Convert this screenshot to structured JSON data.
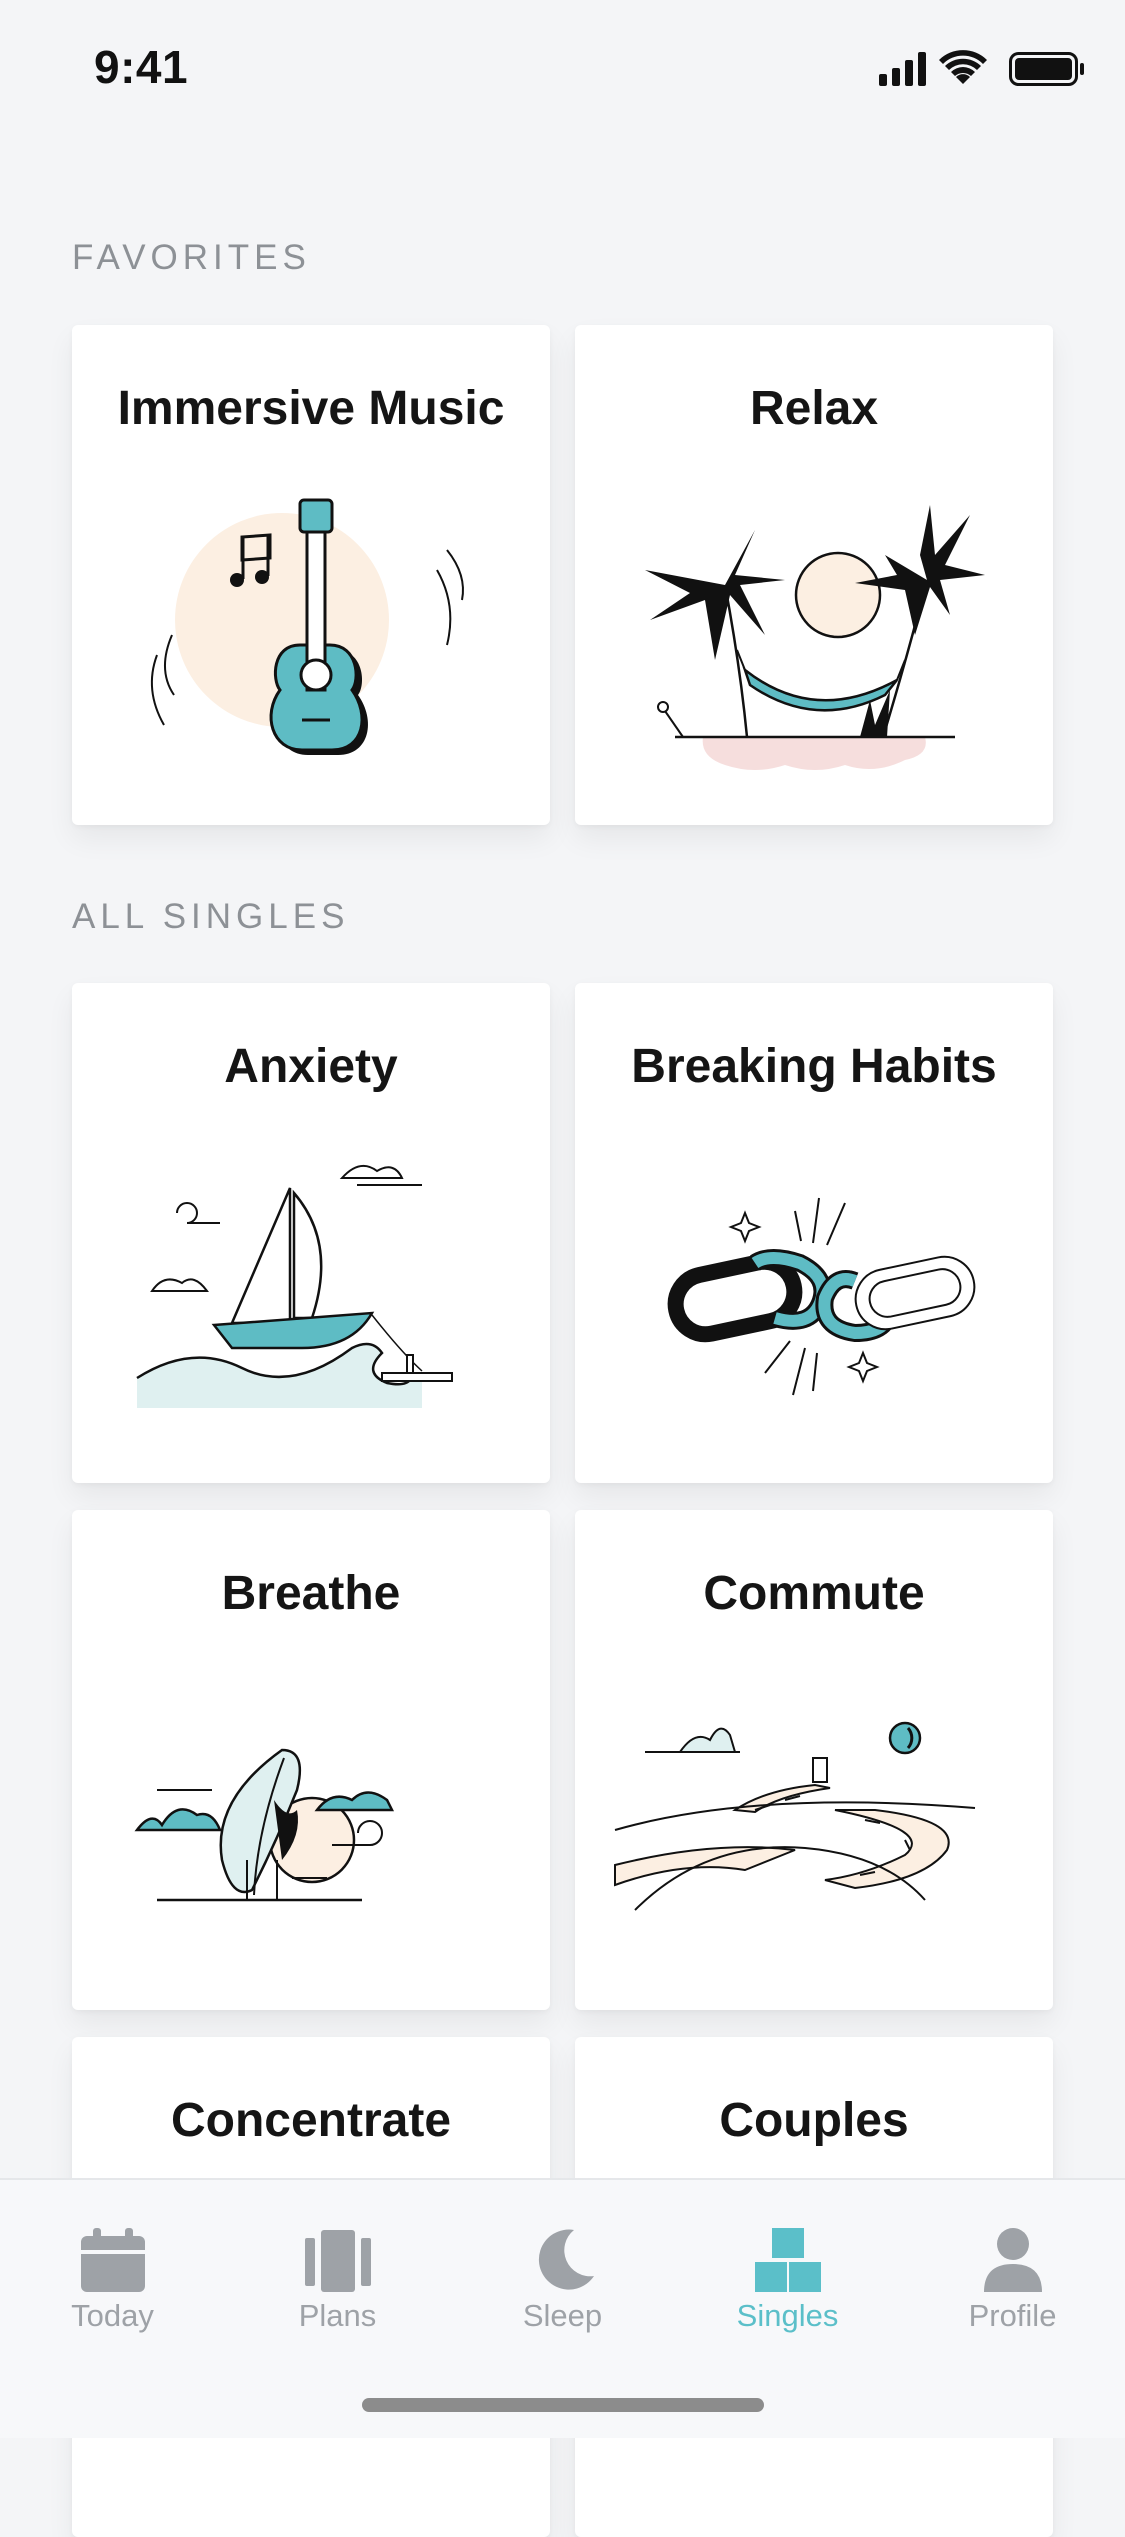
{
  "status": {
    "time": "9:41"
  },
  "sections": {
    "favorites_label": "FAVORITES",
    "all_singles_label": "ALL SINGLES"
  },
  "favorites": [
    {
      "title": "Immersive Music",
      "icon": "guitar-illustration"
    },
    {
      "title": "Relax",
      "icon": "hammock-illustration"
    }
  ],
  "singles": [
    {
      "title": "Anxiety",
      "icon": "sailboat-illustration"
    },
    {
      "title": "Breaking Habits",
      "icon": "broken-chain-illustration"
    },
    {
      "title": "Breathe",
      "icon": "leaf-illustration"
    },
    {
      "title": "Commute",
      "icon": "road-illustration"
    },
    {
      "title": "Concentrate",
      "icon": "concentrate-illustration"
    },
    {
      "title": "Couples",
      "icon": "couples-illustration"
    }
  ],
  "tabs": [
    {
      "label": "Today",
      "icon": "calendar-icon",
      "active": false
    },
    {
      "label": "Plans",
      "icon": "plans-icon",
      "active": false
    },
    {
      "label": "Sleep",
      "icon": "moon-icon",
      "active": false
    },
    {
      "label": "Singles",
      "icon": "singles-icon",
      "active": true
    },
    {
      "label": "Profile",
      "icon": "person-icon",
      "active": false
    }
  ],
  "colors": {
    "accent": "#5bbfc9",
    "teal": "#5ebcc4",
    "peach": "#fcefe2",
    "background": "#f4f5f7",
    "inactive": "#9ea2a7"
  }
}
